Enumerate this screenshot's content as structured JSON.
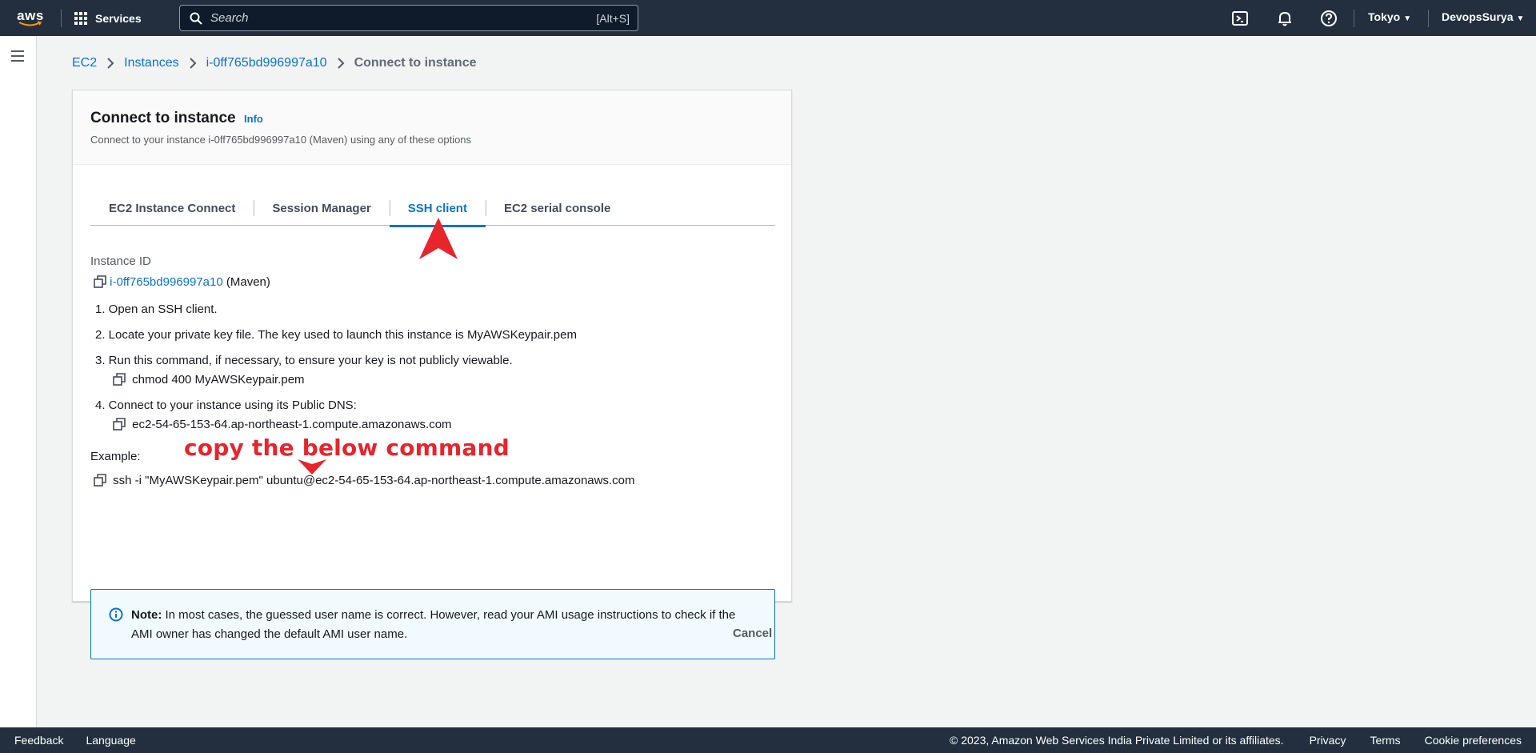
{
  "topnav": {
    "logo_text": "aws",
    "services_label": "Services",
    "search_placeholder": "Search",
    "search_shortcut": "[Alt+S]",
    "region": "Tokyo",
    "account": "DevopsSurya"
  },
  "breadcrumb": {
    "items": [
      "EC2",
      "Instances",
      "i-0ff765bd996997a10"
    ],
    "current": "Connect to instance"
  },
  "panel": {
    "title": "Connect to instance",
    "info_label": "Info",
    "subtitle": "Connect to your instance i-0ff765bd996997a10 (Maven) using any of these options"
  },
  "tabs": [
    {
      "label": "EC2 Instance Connect",
      "active": false
    },
    {
      "label": "Session Manager",
      "active": false
    },
    {
      "label": "SSH client",
      "active": true
    },
    {
      "label": "EC2 serial console",
      "active": false
    }
  ],
  "ssh": {
    "instance_id_label": "Instance ID",
    "instance_id": "i-0ff765bd996997a10",
    "instance_name": "(Maven)",
    "step1": "1. Open an SSH client.",
    "step2": "2. Locate your private key file. The key used to launch this instance is MyAWSKeypair.pem",
    "step3": "3. Run this command, if necessary, to ensure your key is not publicly viewable.",
    "step3_command": "chmod 400 MyAWSKeypair.pem",
    "step4": "4. Connect to your instance using its Public DNS:",
    "step4_dns": "ec2-54-65-153-64.ap-northeast-1.compute.amazonaws.com",
    "example_label": "Example:",
    "example_command": "ssh -i \"MyAWSKeypair.pem\" ubuntu@ec2-54-65-153-64.ap-northeast-1.compute.amazonaws.com"
  },
  "note": {
    "bold": "Note:",
    "text": " In most cases, the guessed user name is correct. However, read your AMI usage instructions to check if the AMI owner has changed the default AMI user name."
  },
  "cancel_label": "Cancel",
  "annotation": {
    "text": "copy the below command",
    "color": "#e8242c"
  },
  "footer": {
    "feedback": "Feedback",
    "language": "Language",
    "copyright": "© 2023, Amazon Web Services India Private Limited or its affiliates.",
    "privacy": "Privacy",
    "terms": "Terms",
    "cookies": "Cookie preferences"
  }
}
